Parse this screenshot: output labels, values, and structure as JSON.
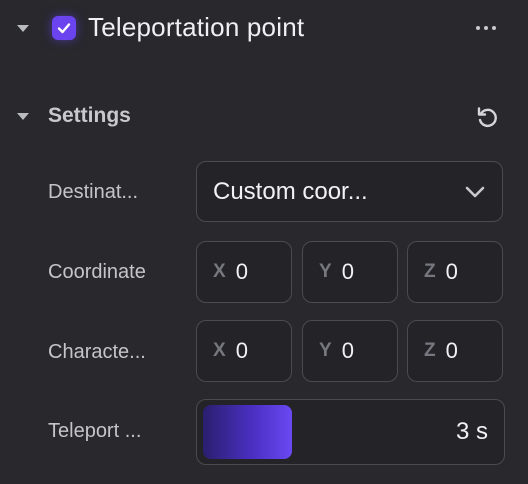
{
  "component": {
    "title": "Teleportation point",
    "enabled": true,
    "more_icon": "more-horizontal-icon"
  },
  "settings": {
    "title": "Settings",
    "reset_icon": "reset-icon",
    "destination": {
      "label": "Destinat...",
      "value": "Custom coor...",
      "icon": "chevron-down-icon"
    },
    "coordinate": {
      "label": "Coordinate",
      "x_label": "X",
      "x": "0",
      "y_label": "Y",
      "y": "0",
      "z_label": "Z",
      "z": "0"
    },
    "character": {
      "label": "Characte...",
      "x_label": "X",
      "x": "0",
      "y_label": "Y",
      "y": "0",
      "z_label": "Z",
      "z": "0"
    },
    "teleport": {
      "label": "Teleport ...",
      "value": "3 s",
      "fill_fraction": 0.3
    }
  },
  "colors": {
    "background": "#28282d",
    "accent": "#6b44f0",
    "field_border": "#4a4a52"
  }
}
